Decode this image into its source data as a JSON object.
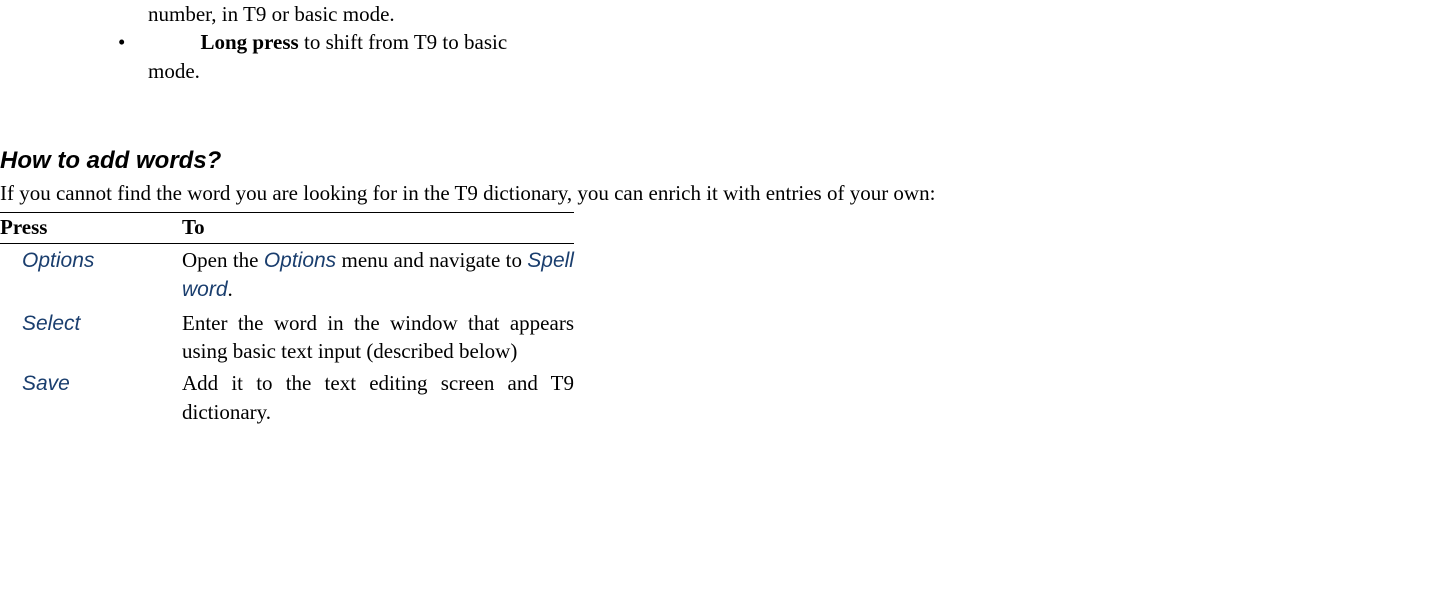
{
  "bullets": {
    "line1": "number, in T9 or basic mode.",
    "mark": "•",
    "long_press_bold": "Long press",
    "long_press_rest": " to shift from T9 to basic mode."
  },
  "heading": "How to add words?",
  "intro": "If you cannot find the word you are looking for in the T9 dictionary, you can enrich it with entries of your own:",
  "table": {
    "header_press": "Press",
    "header_to": "To",
    "rows": [
      {
        "press": "Options",
        "to_before": "Open the ",
        "to_key1": "Options",
        "to_mid": " menu and navigate to ",
        "to_key2": "Spell word",
        "to_after": "."
      },
      {
        "press": "Select",
        "to": "Enter the word in the window that appears using basic text input (described below)"
      },
      {
        "press": "Save",
        "to": "Add it to the text editing screen and T9 dictionary."
      }
    ]
  }
}
